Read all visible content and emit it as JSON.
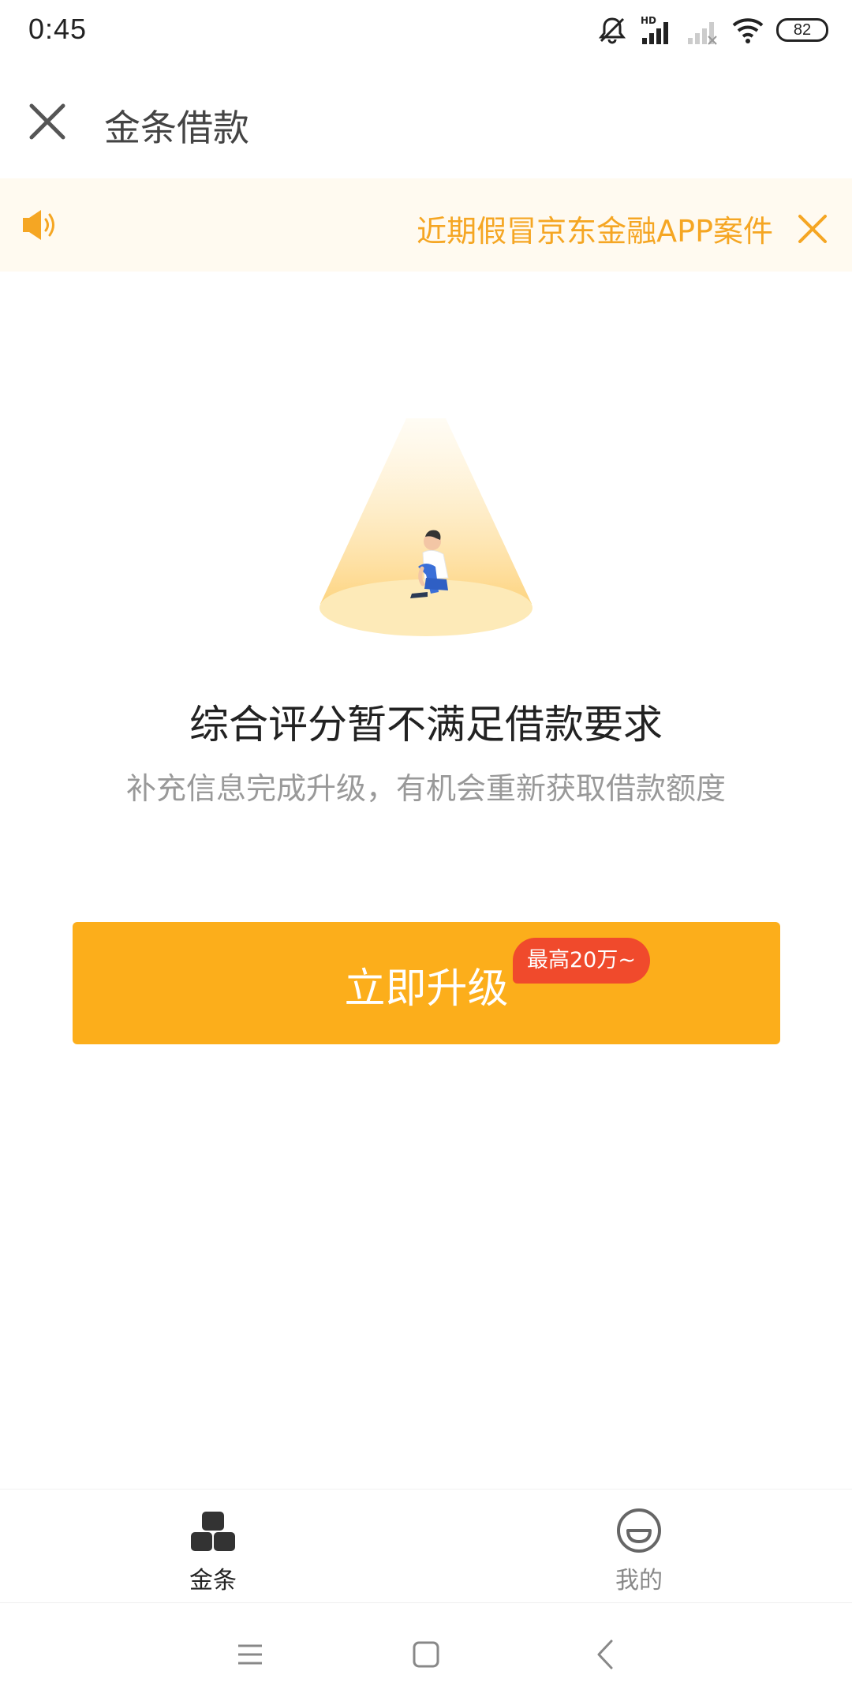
{
  "status_bar": {
    "time": "0:45",
    "battery": "82",
    "network_label": "HD"
  },
  "title_bar": {
    "title": "金条借款"
  },
  "notice": {
    "text": "近期假冒京东金融APP案件"
  },
  "result": {
    "headline": "综合评分暂不满足借款要求",
    "subtext": "补充信息完成升级，有机会重新获取借款额度"
  },
  "cta": {
    "label": "立即升级",
    "badge": "最高20万~"
  },
  "tabs": [
    {
      "label": "金条",
      "icon": "gold-bars-icon",
      "active": true
    },
    {
      "label": "我的",
      "icon": "smiley-icon",
      "active": false
    }
  ],
  "colors": {
    "accent": "#fcae1b",
    "badge": "#f04a2c",
    "notice_text": "#f5a623",
    "notice_bg": "#fffaf0"
  }
}
